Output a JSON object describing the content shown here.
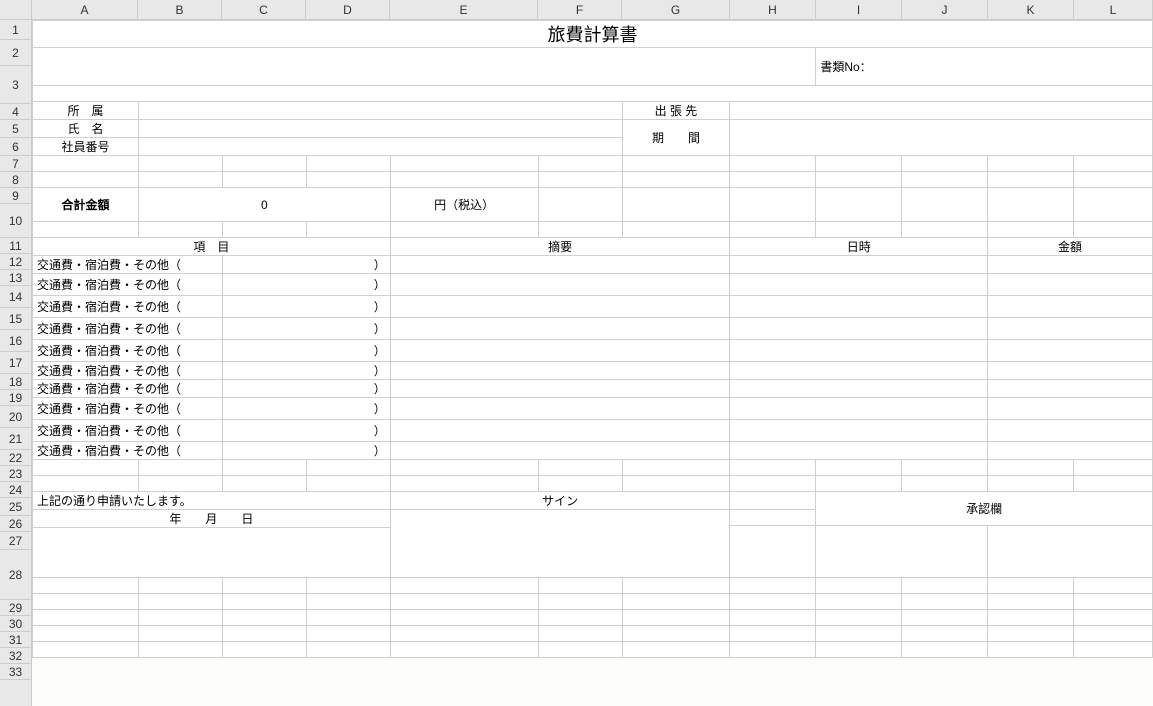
{
  "columns": [
    {
      "letter": "A",
      "w": 106
    },
    {
      "letter": "B",
      "w": 84
    },
    {
      "letter": "C",
      "w": 84
    },
    {
      "letter": "D",
      "w": 84
    },
    {
      "letter": "E",
      "w": 148
    },
    {
      "letter": "F",
      "w": 84
    },
    {
      "letter": "G",
      "w": 108
    },
    {
      "letter": "H",
      "w": 86
    },
    {
      "letter": "I",
      "w": 86
    },
    {
      "letter": "J",
      "w": 86
    },
    {
      "letter": "K",
      "w": 86
    },
    {
      "letter": "L",
      "w": 79
    }
  ],
  "rowHeights": {
    "1": 20,
    "2": 26,
    "3": 38,
    "4": 16,
    "5": 18,
    "6": 18,
    "7": 16,
    "8": 16,
    "9": 16,
    "10": 34,
    "11": 16,
    "12": 16,
    "13": 16,
    "14": 22,
    "15": 22,
    "16": 22,
    "17": 22,
    "18": 16,
    "19": 16,
    "20": 22,
    "21": 22,
    "22": 16,
    "23": 16,
    "24": 16,
    "25": 18,
    "26": 16,
    "27": 18,
    "28": 50,
    "29": 16,
    "30": 16,
    "31": 16,
    "32": 16,
    "33": 16
  },
  "title": "旅費計算書",
  "docNoLabel": "書類No：",
  "labels": {
    "affiliation": "所　属",
    "name": "氏　名",
    "empId": "社員番号",
    "destination": "出 張 先",
    "period": "期　　間",
    "totalLabel": "合計金額",
    "totalValue": "0",
    "totalUnit": "円（税込）",
    "colItem": "項　目",
    "colSummary": "摘要",
    "colDate": "日時",
    "colAmount": "金額",
    "itemTemplate": "交通費・宿泊費・その他（",
    "itemClose": "）",
    "applyText": "上記の通り申請いたします。",
    "dateText": "年　　月　　日",
    "signLabel": "サイン",
    "approvalLabel": "承認欄"
  }
}
